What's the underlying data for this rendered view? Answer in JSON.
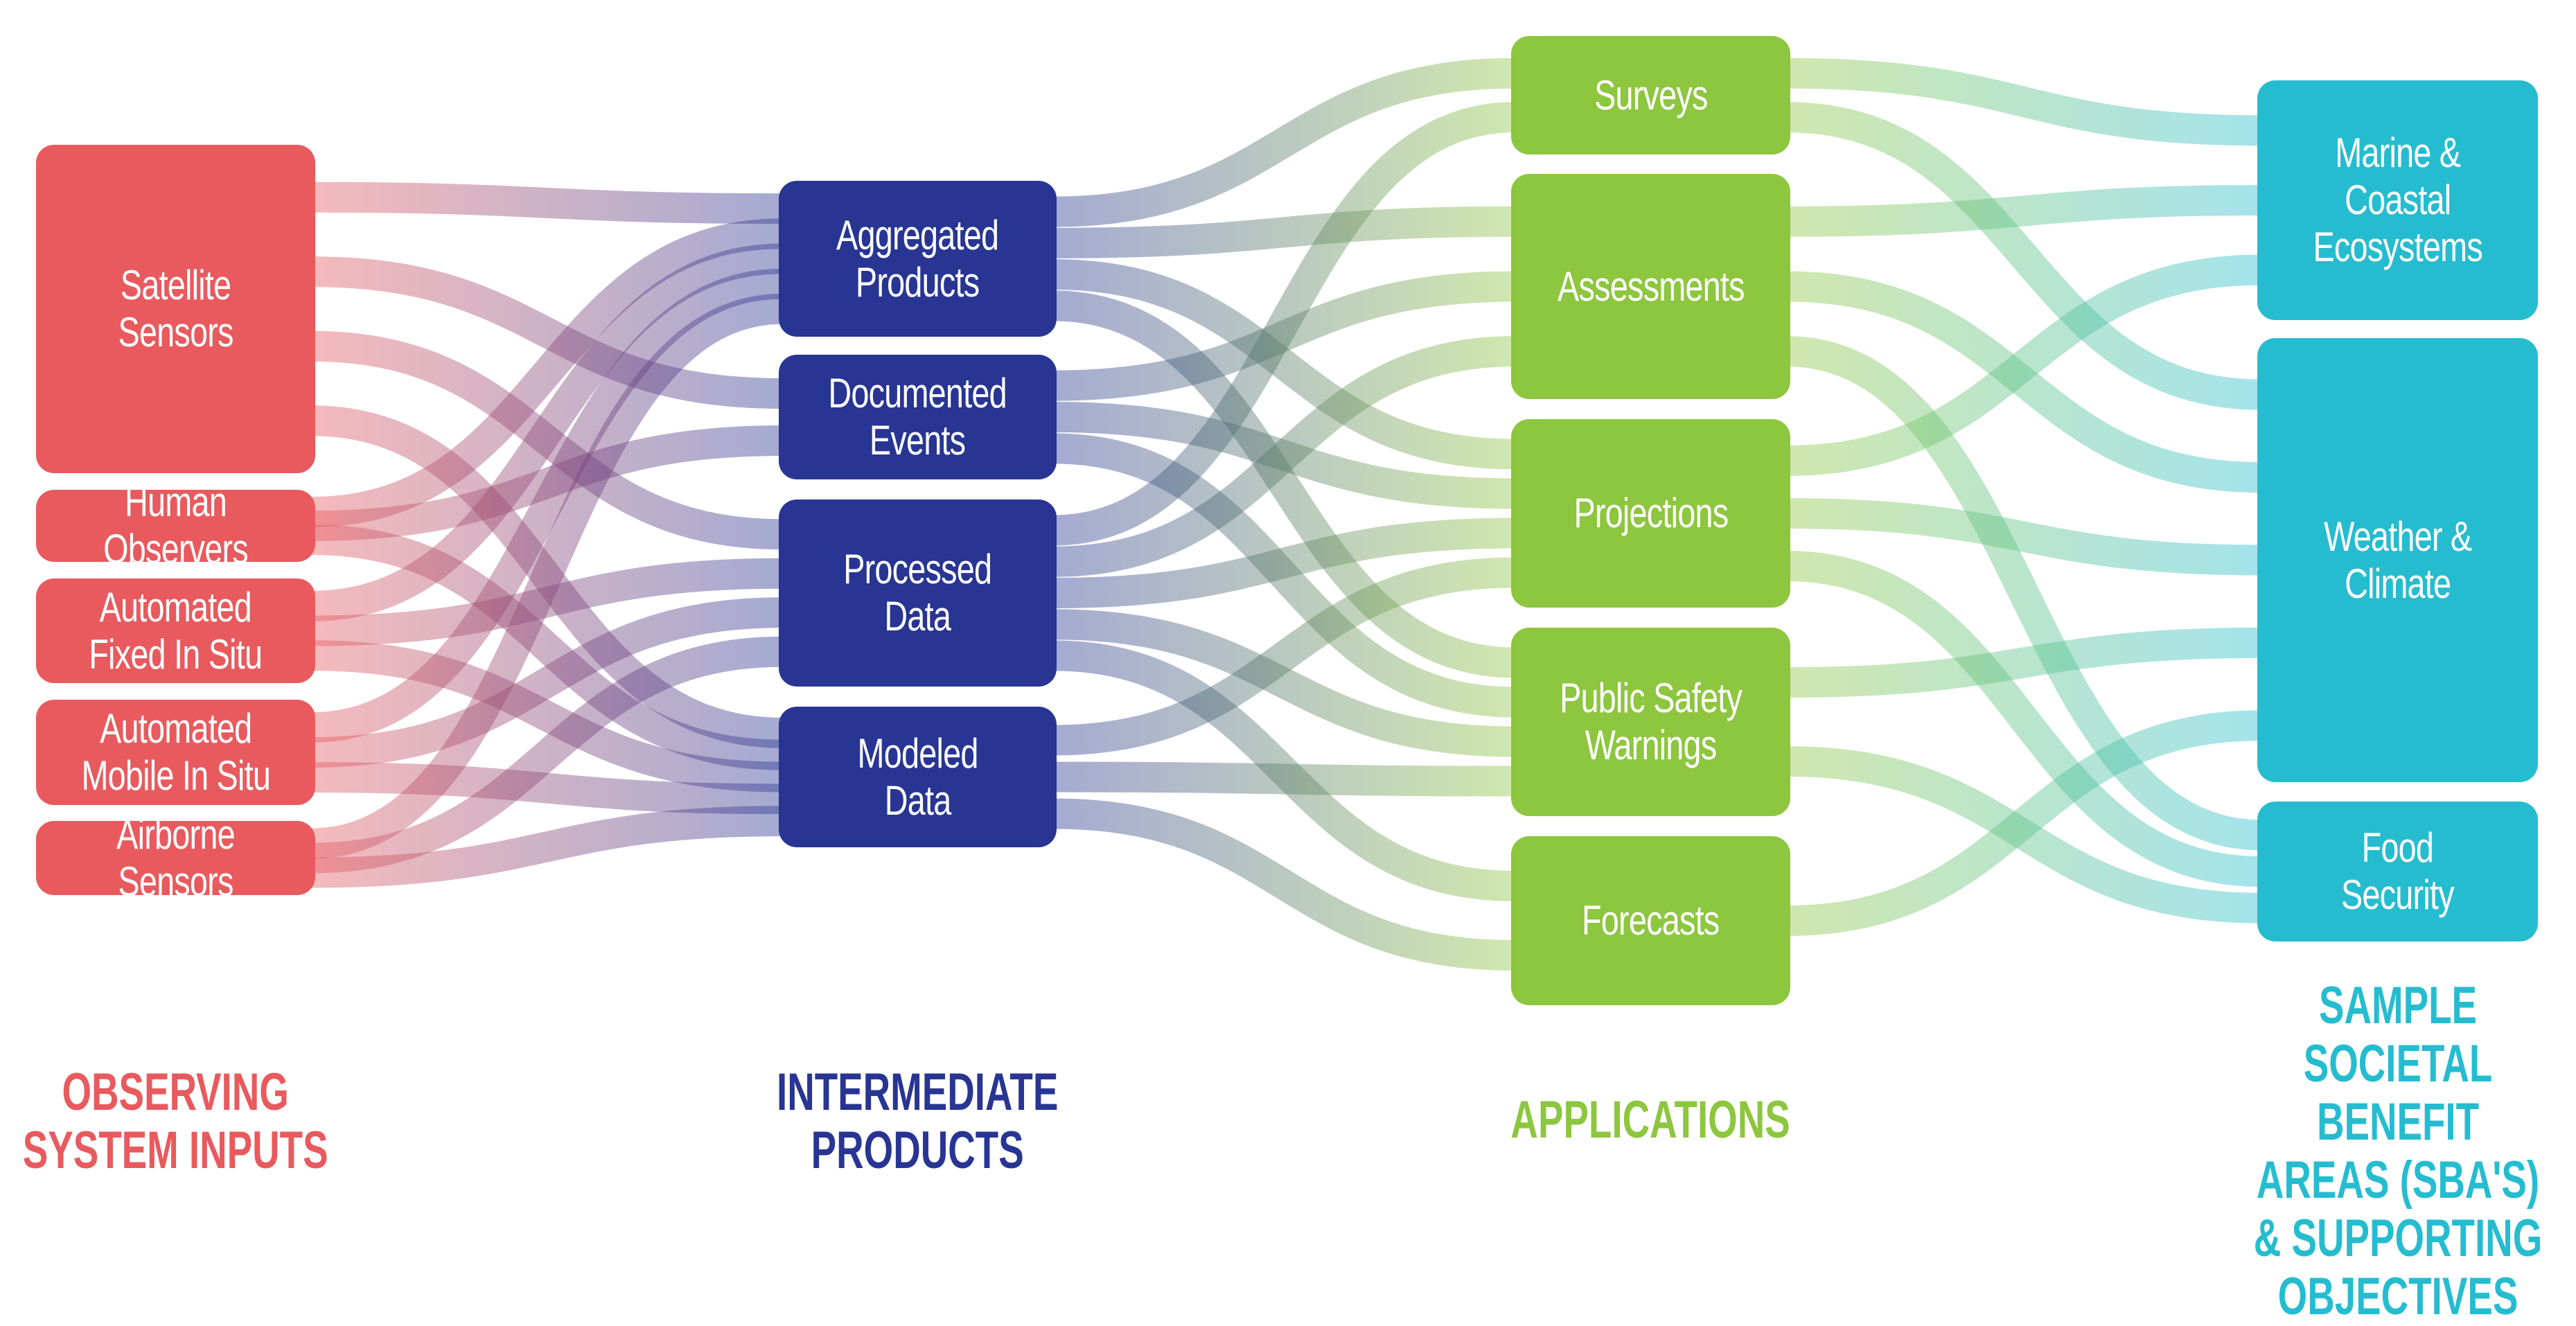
{
  "colors": {
    "inputs": "#e85a5e",
    "intermediate": "#283593",
    "applications": "#8dc63f",
    "sba": "#26bcd0"
  },
  "columns": [
    {
      "title": "OBSERVING\nSYSTEM INPUTS",
      "color_key": "inputs",
      "nodes": [
        {
          "id": "sat",
          "label": "Satellite\nSensors"
        },
        {
          "id": "hum",
          "label": "Human Observers"
        },
        {
          "id": "fix",
          "label": "Automated\nFixed In Situ"
        },
        {
          "id": "mob",
          "label": "Automated\nMobile In Situ"
        },
        {
          "id": "air",
          "label": "Airborne Sensors"
        }
      ]
    },
    {
      "title": "INTERMEDIATE\nPRODUCTS",
      "color_key": "intermediate",
      "nodes": [
        {
          "id": "agg",
          "label": "Aggregated\nProducts"
        },
        {
          "id": "doc",
          "label": "Documented\nEvents"
        },
        {
          "id": "pro",
          "label": "Processed\nData"
        },
        {
          "id": "mod",
          "label": "Modeled\nData"
        }
      ]
    },
    {
      "title": "APPLICATIONS",
      "color_key": "applications",
      "nodes": [
        {
          "id": "sur",
          "label": "Surveys"
        },
        {
          "id": "ass",
          "label": "Assessments"
        },
        {
          "id": "prj",
          "label": "Projections"
        },
        {
          "id": "psw",
          "label": "Public Safety\nWarnings"
        },
        {
          "id": "for",
          "label": "Forecasts"
        }
      ]
    },
    {
      "title": "SAMPLE\nSOCIETAL BENEFIT\nAREAS (SBA'S)\n& SUPPORTING\nOBJECTIVES",
      "color_key": "sba",
      "nodes": [
        {
          "id": "mar",
          "label": "Marine &\nCoastal\nEcosystems"
        },
        {
          "id": "wea",
          "label": "Weather &\nClimate"
        },
        {
          "id": "foo",
          "label": "Food\nSecurity"
        }
      ]
    }
  ],
  "links": [
    [
      "sat",
      "agg"
    ],
    [
      "sat",
      "doc"
    ],
    [
      "sat",
      "pro"
    ],
    [
      "sat",
      "mod"
    ],
    [
      "hum",
      "agg"
    ],
    [
      "hum",
      "doc"
    ],
    [
      "hum",
      "mod"
    ],
    [
      "fix",
      "agg"
    ],
    [
      "fix",
      "pro"
    ],
    [
      "fix",
      "mod"
    ],
    [
      "mob",
      "agg"
    ],
    [
      "mob",
      "pro"
    ],
    [
      "mob",
      "mod"
    ],
    [
      "air",
      "agg"
    ],
    [
      "air",
      "pro"
    ],
    [
      "air",
      "mod"
    ],
    [
      "agg",
      "sur"
    ],
    [
      "agg",
      "ass"
    ],
    [
      "agg",
      "prj"
    ],
    [
      "agg",
      "psw"
    ],
    [
      "doc",
      "ass"
    ],
    [
      "doc",
      "prj"
    ],
    [
      "doc",
      "psw"
    ],
    [
      "pro",
      "sur"
    ],
    [
      "pro",
      "ass"
    ],
    [
      "pro",
      "prj"
    ],
    [
      "pro",
      "psw"
    ],
    [
      "pro",
      "for"
    ],
    [
      "mod",
      "prj"
    ],
    [
      "mod",
      "psw"
    ],
    [
      "mod",
      "for"
    ],
    [
      "sur",
      "mar"
    ],
    [
      "sur",
      "wea"
    ],
    [
      "ass",
      "mar"
    ],
    [
      "ass",
      "wea"
    ],
    [
      "ass",
      "foo"
    ],
    [
      "prj",
      "mar"
    ],
    [
      "prj",
      "wea"
    ],
    [
      "prj",
      "foo"
    ],
    [
      "psw",
      "wea"
    ],
    [
      "psw",
      "foo"
    ],
    [
      "for",
      "wea"
    ]
  ]
}
